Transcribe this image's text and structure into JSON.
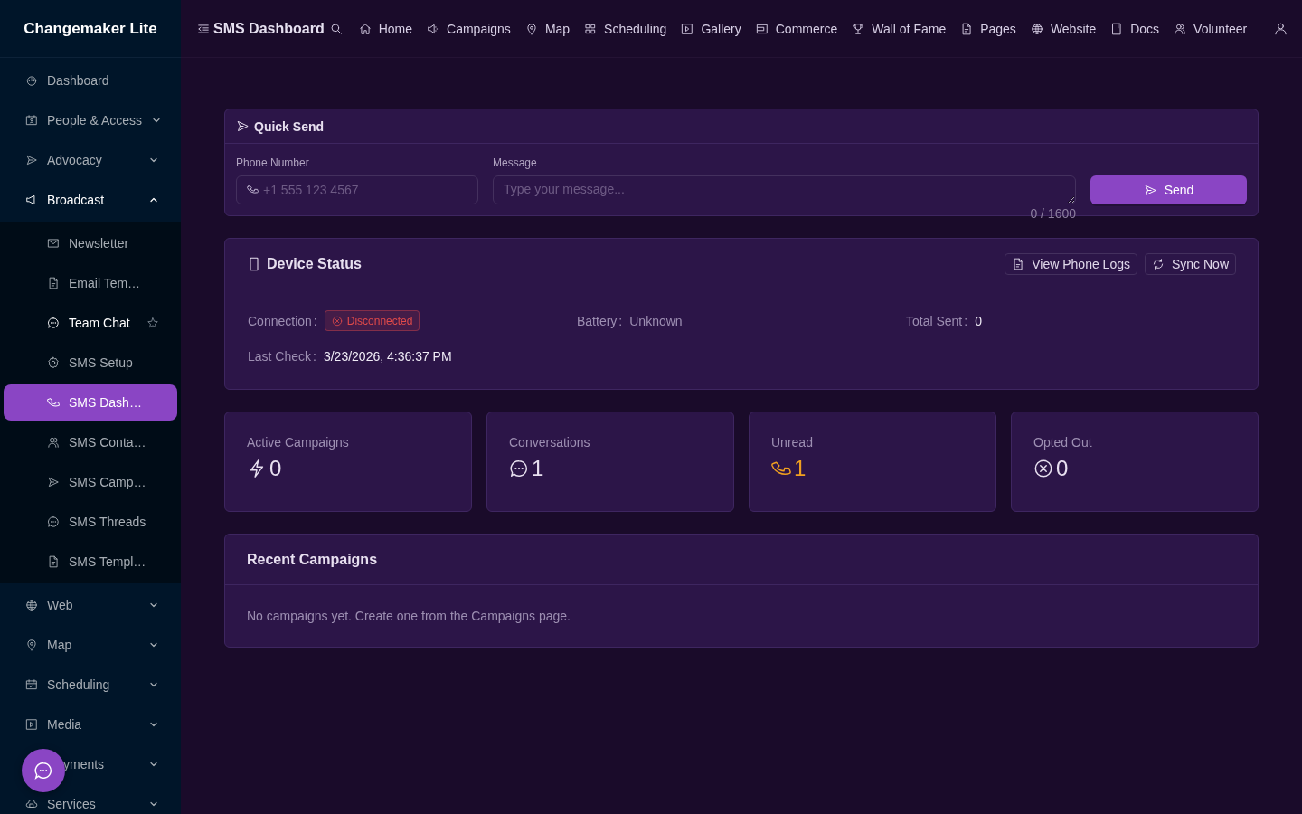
{
  "sidebar": {
    "brand": "Changemaker Lite",
    "items": [
      {
        "label": "Dashboard",
        "selected": false
      },
      {
        "label": "People & Access",
        "selected": false,
        "expanded": false
      },
      {
        "label": "Advocacy",
        "selected": false,
        "expanded": false
      },
      {
        "label": "Broadcast",
        "selected": false,
        "expanded": true,
        "children": [
          {
            "label": "Newsletter",
            "selected": false
          },
          {
            "label": "Email Tem…",
            "selected": false
          },
          {
            "label": "Team Chat",
            "selected": false,
            "starred": false
          },
          {
            "label": "SMS Setup",
            "selected": false
          },
          {
            "label": "SMS Dash…",
            "selected": true
          },
          {
            "label": "SMS Conta…",
            "selected": false
          },
          {
            "label": "SMS Camp…",
            "selected": false
          },
          {
            "label": "SMS Threads",
            "selected": false
          },
          {
            "label": "SMS Templ…",
            "selected": false
          }
        ]
      },
      {
        "label": "Web",
        "selected": false,
        "expanded": false
      },
      {
        "label": "Map",
        "selected": false,
        "expanded": false
      },
      {
        "label": "Scheduling",
        "selected": false,
        "expanded": false
      },
      {
        "label": "Media",
        "selected": false,
        "expanded": false
      },
      {
        "label": "yments",
        "selected": false,
        "expanded": false
      },
      {
        "label": "Services",
        "selected": false,
        "expanded": false
      }
    ]
  },
  "topbar": {
    "title": "SMS Dashboard",
    "links": [
      "Home",
      "Campaigns",
      "Map",
      "Scheduling",
      "Gallery",
      "Commerce",
      "Wall of Fame",
      "Pages",
      "Website",
      "Docs",
      "Volunteer"
    ]
  },
  "quick_send": {
    "title": "Quick Send",
    "phone_label": "Phone Number",
    "phone_placeholder": "+1 555 123 4567",
    "message_label": "Message",
    "message_placeholder": "Type your message...",
    "counter": "0 / 1600",
    "button": "Send"
  },
  "device_status": {
    "title": "Device Status",
    "buttons": [
      "View Phone Logs",
      "Sync Now"
    ],
    "fields": [
      {
        "label": "Connection",
        "separator": ":",
        "kind": "tag",
        "value": "Disconnected",
        "color": "#e04a4a"
      },
      {
        "label": "Battery",
        "separator": ":",
        "kind": "muted",
        "value": "Unknown"
      },
      {
        "label": "Total Sent",
        "separator": ":",
        "kind": "plain",
        "value": "0"
      },
      {
        "label": "Last Check",
        "separator": ":",
        "kind": "plain",
        "value": "3/23/2026, 4:36:37 PM"
      }
    ]
  },
  "stats": [
    {
      "label": "Active Campaigns",
      "value": "0",
      "color": "#e8e0f0"
    },
    {
      "label": "Conversations",
      "value": "1",
      "color": "#e8e0f0"
    },
    {
      "label": "Unread",
      "value": "1",
      "color": "#f0a020"
    },
    {
      "label": "Opted Out",
      "value": "0",
      "color": "#e8e0f0"
    }
  ],
  "recent_campaigns": {
    "title": "Recent Campaigns",
    "empty_text": "No campaigns yet. Create one from the Campaigns page."
  }
}
